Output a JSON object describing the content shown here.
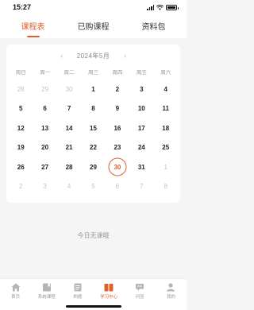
{
  "status_bar": {
    "time": "15:27"
  },
  "tabs": [
    {
      "label": "课程表",
      "active": true
    },
    {
      "label": "已购课程",
      "active": false
    },
    {
      "label": "资料包",
      "active": false
    }
  ],
  "calendar": {
    "title": "2024年5月",
    "weekdays": [
      "周日",
      "周一",
      "周二",
      "周三",
      "周四",
      "周五",
      "周六"
    ],
    "rows": [
      [
        {
          "d": "28",
          "dim": true
        },
        {
          "d": "29",
          "dim": true
        },
        {
          "d": "30",
          "dim": true
        },
        {
          "d": "1"
        },
        {
          "d": "2"
        },
        {
          "d": "3"
        },
        {
          "d": "4"
        }
      ],
      [
        {
          "d": "5"
        },
        {
          "d": "6"
        },
        {
          "d": "7"
        },
        {
          "d": "8"
        },
        {
          "d": "9"
        },
        {
          "d": "10"
        },
        {
          "d": "11"
        }
      ],
      [
        {
          "d": "12"
        },
        {
          "d": "13"
        },
        {
          "d": "14"
        },
        {
          "d": "15"
        },
        {
          "d": "16"
        },
        {
          "d": "17"
        },
        {
          "d": "18"
        }
      ],
      [
        {
          "d": "19"
        },
        {
          "d": "20"
        },
        {
          "d": "21"
        },
        {
          "d": "22"
        },
        {
          "d": "23"
        },
        {
          "d": "24"
        },
        {
          "d": "25"
        }
      ],
      [
        {
          "d": "26"
        },
        {
          "d": "27"
        },
        {
          "d": "28"
        },
        {
          "d": "29"
        },
        {
          "d": "30",
          "today": true
        },
        {
          "d": "31"
        },
        {
          "d": "1",
          "dim": true
        }
      ],
      [
        {
          "d": "2",
          "dim": true
        },
        {
          "d": "3",
          "dim": true
        },
        {
          "d": "4",
          "dim": true
        },
        {
          "d": "5",
          "dim": true
        },
        {
          "d": "6",
          "dim": true
        },
        {
          "d": "7",
          "dim": true
        },
        {
          "d": "8",
          "dim": true
        }
      ]
    ]
  },
  "empty_message": "今日无课哦",
  "bottom_nav": [
    {
      "label": "首页",
      "icon": "home-icon",
      "active": false
    },
    {
      "label": "系统课程",
      "icon": "course-icon",
      "active": false
    },
    {
      "label": "刷题",
      "icon": "quiz-icon",
      "active": false
    },
    {
      "label": "学习中心",
      "icon": "study-center-icon",
      "active": true
    },
    {
      "label": "问答",
      "icon": "qa-icon",
      "active": false
    },
    {
      "label": "我的",
      "icon": "profile-icon",
      "active": false
    }
  ],
  "colors": {
    "accent": "#e0602b",
    "background": "#f5f5f5",
    "dim_text": "#c4c4c4"
  }
}
